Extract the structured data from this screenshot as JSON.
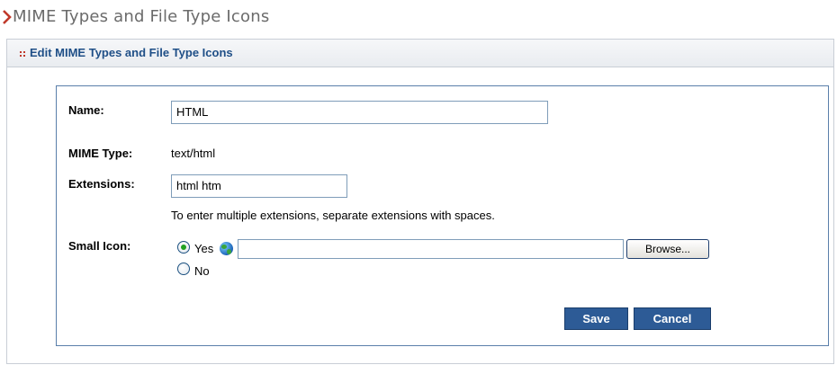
{
  "page": {
    "title": "MIME Types and File Type Icons"
  },
  "panel": {
    "title": "Edit MIME Types and File Type Icons"
  },
  "form": {
    "name_label": "Name:",
    "name_value": "HTML",
    "mime_label": "MIME Type:",
    "mime_value": "text/html",
    "extensions_label": "Extensions:",
    "extensions_value": "html htm",
    "extensions_hint": "To enter multiple extensions, separate extensions with spaces.",
    "small_icon_label": "Small Icon:",
    "radio_yes_label": "Yes",
    "radio_no_label": "No",
    "selected_option": "Yes",
    "icon_path_value": "",
    "browse_label": "Browse...",
    "save_label": "Save",
    "cancel_label": "Cancel"
  },
  "icons": {
    "header_marker": "chevron-right-icon",
    "panel_marker": "grip-dots-icon",
    "file_icon": "globe-icon"
  },
  "colors": {
    "chevron": "#c0392b",
    "title_text": "#6b6b6b",
    "panel_title": "#1f4f87",
    "button_bg": "#2d5b96",
    "form_border": "#5a7faa"
  }
}
